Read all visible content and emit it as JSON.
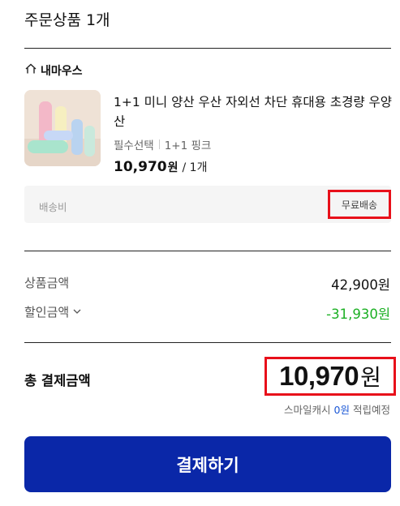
{
  "order": {
    "title": "주문상품 1개"
  },
  "seller": {
    "name": "내마우스"
  },
  "product": {
    "name": "1+1 미니 양산 우산 자외선 차단 휴대용 초경량 우양산",
    "option_label": "필수선택",
    "option_value": "1+1 핑크",
    "price": "10,970",
    "price_unit": "원",
    "quantity": "/ 1개"
  },
  "shipping": {
    "label": "배송비",
    "value": "무료배송"
  },
  "summary": {
    "product_amount_label": "상품금액",
    "product_amount_value": "42,900원",
    "discount_label": "할인금액",
    "discount_value": "-31,930원"
  },
  "total": {
    "label": "총 결제금액",
    "amount": "10,970",
    "unit": "원",
    "smile_prefix": "스마일캐시",
    "smile_amount": "0원",
    "smile_suffix": "적립예정"
  },
  "pay_button": {
    "label": "결제하기"
  },
  "colors": {
    "accent_blue": "#0a27a8",
    "highlight_red": "#e8101a",
    "discount_green": "#1cb024"
  }
}
